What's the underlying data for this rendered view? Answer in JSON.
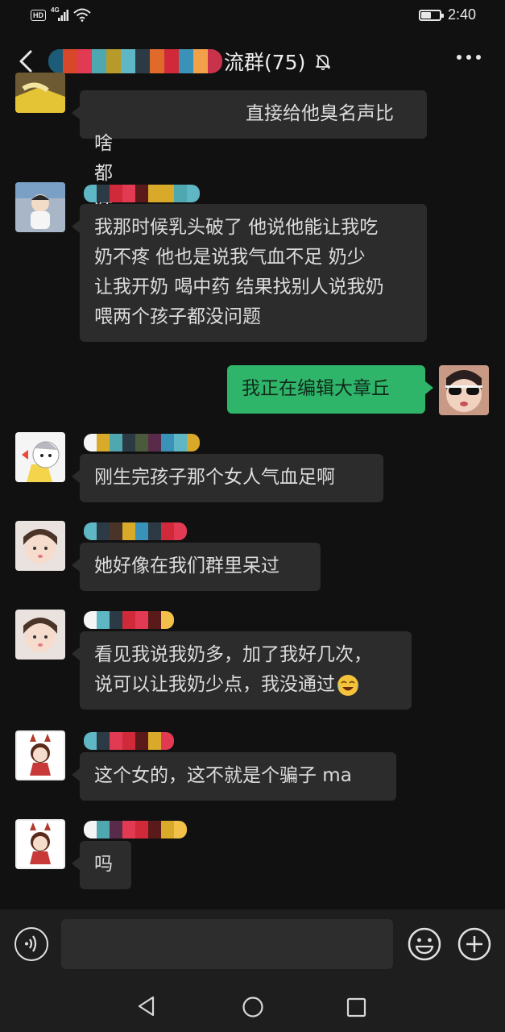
{
  "status_bar": {
    "hd": "HD",
    "network": "4G",
    "time": "2:40",
    "battery_level": 0.55
  },
  "header": {
    "title_suffix": "流群(75)",
    "back_icon": "chevron-left-icon",
    "mute_icon": "bell-muted-icon",
    "more_icon": "more-icon"
  },
  "messages": [
    {
      "from": "other",
      "text_lines": [
        "直接给他臭名声比",
        "啥都好使"
      ]
    },
    {
      "from": "other",
      "text_lines": [
        "我那时候乳头破了 他说他能让我吃",
        "奶不疼 他也是说我气血不足 奶少",
        "让我开奶 喝中药 结果找别人说我奶",
        "喂两个孩子都没问题"
      ]
    },
    {
      "from": "me",
      "text_lines": [
        "我正在编辑大章丘"
      ]
    },
    {
      "from": "other",
      "text_lines": [
        "刚生完孩子那个女人气血足啊"
      ]
    },
    {
      "from": "other",
      "text_lines": [
        "她好像在我们群里呆过"
      ]
    },
    {
      "from": "other",
      "text_lines": [
        "看见我说我奶多，加了我好几次，",
        "说可以让我奶少点，我没通过"
      ]
    },
    {
      "from": "other",
      "text_lines": [
        "这个女的，这不就是个骗子 ma"
      ]
    },
    {
      "from": "other",
      "text_lines": [
        "吗"
      ]
    }
  ],
  "input": {
    "voice_icon": "voice-icon",
    "emoji_icon": "emoji-icon",
    "plus_icon": "plus-icon",
    "placeholder": ""
  },
  "nav": {
    "back_icon": "nav-back-icon",
    "home_icon": "nav-home-icon",
    "recent_icon": "nav-recent-icon"
  },
  "colors": {
    "background": "#111111",
    "bubble_other": "#2c2c2c",
    "bubble_mine": "#2fb56a"
  }
}
